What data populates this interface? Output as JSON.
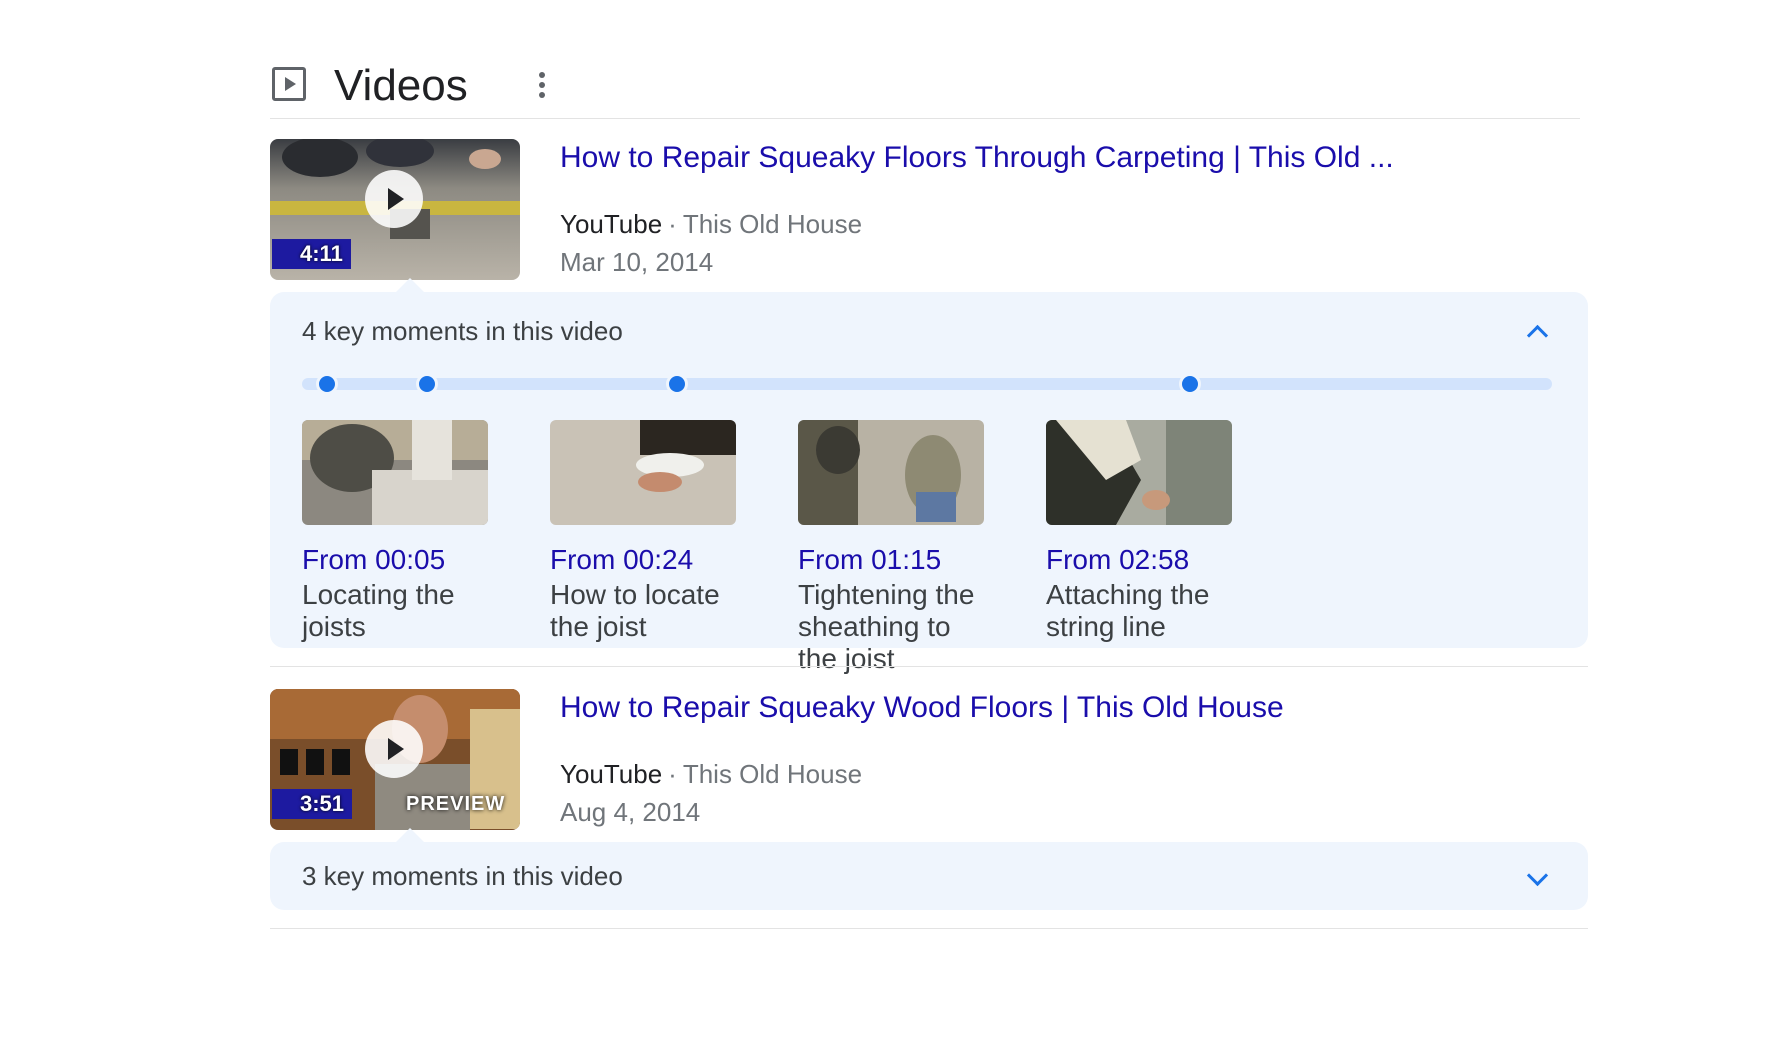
{
  "section": {
    "title": "Videos",
    "icon": "video-play-icon",
    "more_icon": "more-vert-icon"
  },
  "videos": [
    {
      "title": "How to Repair Squeaky Floors Through Carpeting | This Old ...",
      "source": "YouTube",
      "separator": "·",
      "channel": "This Old House",
      "date": "Mar 10, 2014",
      "duration": "4:11",
      "badge": "",
      "key_moments": {
        "heading": "4 key moments in this video",
        "expanded": true,
        "toggle_icon": "chevron-up-icon",
        "marker_fractions": [
          0.02,
          0.1,
          0.3,
          0.71
        ],
        "items": [
          {
            "from": "From 00:05",
            "desc": "Locating the joists"
          },
          {
            "from": "From 00:24",
            "desc": "How to locate the joist"
          },
          {
            "from": "From 01:15",
            "desc": "Tightening the sheathing to the joist"
          },
          {
            "from": "From 02:58",
            "desc": "Attaching the string line"
          }
        ]
      }
    },
    {
      "title": "How to Repair Squeaky Wood Floors | This Old House",
      "source": "YouTube",
      "separator": "·",
      "channel": "This Old House",
      "date": "Aug 4, 2014",
      "duration": "3:51",
      "badge": "PREVIEW",
      "key_moments": {
        "heading": "3 key moments in this video",
        "expanded": false,
        "toggle_icon": "chevron-down-icon"
      }
    }
  ],
  "colors": {
    "link": "#1a0dab",
    "accent": "#1a73e8",
    "panel_bg": "#eff5fd",
    "track": "#d2e3fc",
    "muted": "#70757a"
  }
}
